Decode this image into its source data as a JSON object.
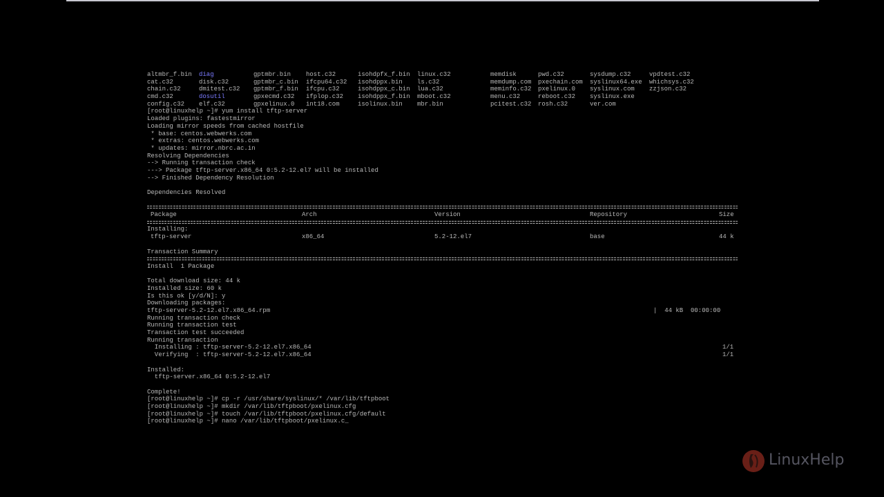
{
  "listing": {
    "rows": [
      [
        "altmbr_f.bin",
        "diag",
        "gptmbr.bin",
        "host.c32",
        "isohdpfx_f.bin",
        "linux.c32",
        "memdisk",
        "pwd.c32",
        "sysdump.c32",
        "vpdtest.c32"
      ],
      [
        "cat.c32",
        "disk.c32",
        "gptmbr_c.bin",
        "ifcpu64.c32",
        "isohdppx.bin",
        "ls.c32",
        "memdump.com",
        "pxechain.com",
        "syslinux64.exe",
        "whichsys.c32"
      ],
      [
        "chain.c32",
        "dmitest.c32",
        "gptmbr_f.bin",
        "ifcpu.c32",
        "isohdppx_c.bin",
        "lua.c32",
        "meminfo.c32",
        "pxelinux.0",
        "syslinux.com",
        "zzjson.c32"
      ],
      [
        "cmd.c32",
        "dosutil",
        "gpxecmd.c32",
        "ifplop.c32",
        "isohdppx_f.bin",
        "mboot.c32",
        "menu.c32",
        "reboot.c32",
        "syslinux.exe",
        ""
      ],
      [
        "config.c32",
        "elf.c32",
        "gpxelinux.0",
        "int18.com",
        "isolinux.bin",
        "mbr.bin",
        "pcitest.c32",
        "rosh.c32",
        "ver.com",
        ""
      ]
    ],
    "dirs": [
      "diag",
      "dosutil"
    ]
  },
  "install_log": [
    "[root@linuxhelp ~]# yum install tftp-server",
    "Loaded plugins: fastestmirror",
    "Loading mirror speeds from cached hostfile",
    " * base: centos.webwerks.com",
    " * extras: centos.webwerks.com",
    " * updates: mirror.nbrc.ac.in",
    "Resolving Dependencies",
    "--> Running transaction check",
    "---> Package tftp-server.x86_64 0:5.2-12.el7 will be installed",
    "--> Finished Dependency Resolution",
    "",
    "Dependencies Resolved",
    ""
  ],
  "table": {
    "headers": [
      "Package",
      "Arch",
      "Version",
      "Repository",
      "Size"
    ],
    "section_label": "Installing:",
    "rows": [
      [
        "tftp-server",
        "x86_64",
        "5.2-12.el7",
        "base",
        "44 k"
      ]
    ]
  },
  "summary": {
    "title": "Transaction Summary",
    "install_line": "Install  1 Package"
  },
  "post_log": [
    "",
    "Total download size: 44 k",
    "Installed size: 60 k",
    "Is this ok [y/d/N]: y",
    "Downloading packages:"
  ],
  "download": {
    "file": "tftp-server-5.2-12.el7.x86_64.rpm",
    "progress": "|  44 kB  00:00:00"
  },
  "transaction_log": [
    "Running transaction check",
    "Running transaction test",
    "Transaction test succeeded",
    "Running transaction"
  ],
  "steps": [
    {
      "label": "  Installing : tftp-server-5.2-12.el7.x86_64",
      "count": "1/1"
    },
    {
      "label": "  Verifying  : tftp-server-5.2-12.el7.x86_64",
      "count": "1/1"
    }
  ],
  "final_log": [
    "",
    "Installed:",
    "  tftp-server.x86_64 0:5.2-12.el7",
    "",
    "Complete!",
    "[root@linuxhelp ~]# cp -r /usr/share/syslinux/* /var/lib/tftpboot",
    "[root@linuxhelp ~]# mkdir /var/lib/tftpboot/pxelinux.cfg",
    "[root@linuxhelp ~]# touch /var/lib/tftpboot/pxelinux.cfg/default"
  ],
  "prompt": {
    "text": "[root@linuxhelp ~]# nano /var/lib/tftpboot/pxelinux.c",
    "cursor": "_"
  },
  "watermark": {
    "text": "LinuxHelp",
    "mark_color": "#c0392b"
  },
  "colors": {
    "background": "#000000",
    "text": "#b8b8b8",
    "directory": "#7b7bff"
  }
}
